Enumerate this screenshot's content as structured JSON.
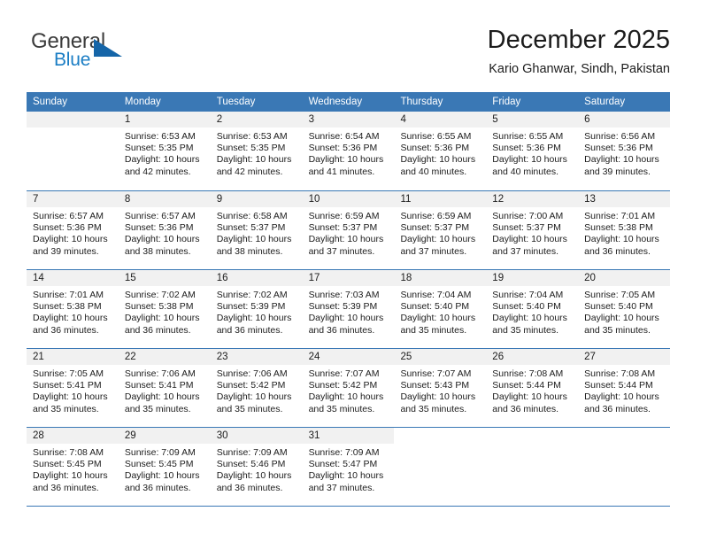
{
  "brand": {
    "word_one": "General",
    "word_two": "Blue",
    "logo_icon": "triangle-logo-icon"
  },
  "header": {
    "title": "December 2025",
    "subtitle": "Kario Ghanwar, Sindh, Pakistan"
  },
  "colors": {
    "header_blue": "#3a78b5",
    "brand_blue": "#1a7dc4",
    "logo_blue": "#1565a8",
    "day_band": "#f1f1f1",
    "text": "#1c1c1c"
  },
  "weekdays": [
    "Sunday",
    "Monday",
    "Tuesday",
    "Wednesday",
    "Thursday",
    "Friday",
    "Saturday"
  ],
  "weeks": [
    [
      {
        "day": "",
        "sunrise": "",
        "sunset": "",
        "daylight_line1": "",
        "daylight_line2": "",
        "empty": true
      },
      {
        "day": "1",
        "sunrise": "Sunrise: 6:53 AM",
        "sunset": "Sunset: 5:35 PM",
        "daylight_line1": "Daylight: 10 hours",
        "daylight_line2": "and 42 minutes."
      },
      {
        "day": "2",
        "sunrise": "Sunrise: 6:53 AM",
        "sunset": "Sunset: 5:35 PM",
        "daylight_line1": "Daylight: 10 hours",
        "daylight_line2": "and 42 minutes."
      },
      {
        "day": "3",
        "sunrise": "Sunrise: 6:54 AM",
        "sunset": "Sunset: 5:36 PM",
        "daylight_line1": "Daylight: 10 hours",
        "daylight_line2": "and 41 minutes."
      },
      {
        "day": "4",
        "sunrise": "Sunrise: 6:55 AM",
        "sunset": "Sunset: 5:36 PM",
        "daylight_line1": "Daylight: 10 hours",
        "daylight_line2": "and 40 minutes."
      },
      {
        "day": "5",
        "sunrise": "Sunrise: 6:55 AM",
        "sunset": "Sunset: 5:36 PM",
        "daylight_line1": "Daylight: 10 hours",
        "daylight_line2": "and 40 minutes."
      },
      {
        "day": "6",
        "sunrise": "Sunrise: 6:56 AM",
        "sunset": "Sunset: 5:36 PM",
        "daylight_line1": "Daylight: 10 hours",
        "daylight_line2": "and 39 minutes."
      }
    ],
    [
      {
        "day": "7",
        "sunrise": "Sunrise: 6:57 AM",
        "sunset": "Sunset: 5:36 PM",
        "daylight_line1": "Daylight: 10 hours",
        "daylight_line2": "and 39 minutes."
      },
      {
        "day": "8",
        "sunrise": "Sunrise: 6:57 AM",
        "sunset": "Sunset: 5:36 PM",
        "daylight_line1": "Daylight: 10 hours",
        "daylight_line2": "and 38 minutes."
      },
      {
        "day": "9",
        "sunrise": "Sunrise: 6:58 AM",
        "sunset": "Sunset: 5:37 PM",
        "daylight_line1": "Daylight: 10 hours",
        "daylight_line2": "and 38 minutes."
      },
      {
        "day": "10",
        "sunrise": "Sunrise: 6:59 AM",
        "sunset": "Sunset: 5:37 PM",
        "daylight_line1": "Daylight: 10 hours",
        "daylight_line2": "and 37 minutes."
      },
      {
        "day": "11",
        "sunrise": "Sunrise: 6:59 AM",
        "sunset": "Sunset: 5:37 PM",
        "daylight_line1": "Daylight: 10 hours",
        "daylight_line2": "and 37 minutes."
      },
      {
        "day": "12",
        "sunrise": "Sunrise: 7:00 AM",
        "sunset": "Sunset: 5:37 PM",
        "daylight_line1": "Daylight: 10 hours",
        "daylight_line2": "and 37 minutes."
      },
      {
        "day": "13",
        "sunrise": "Sunrise: 7:01 AM",
        "sunset": "Sunset: 5:38 PM",
        "daylight_line1": "Daylight: 10 hours",
        "daylight_line2": "and 36 minutes."
      }
    ],
    [
      {
        "day": "14",
        "sunrise": "Sunrise: 7:01 AM",
        "sunset": "Sunset: 5:38 PM",
        "daylight_line1": "Daylight: 10 hours",
        "daylight_line2": "and 36 minutes."
      },
      {
        "day": "15",
        "sunrise": "Sunrise: 7:02 AM",
        "sunset": "Sunset: 5:38 PM",
        "daylight_line1": "Daylight: 10 hours",
        "daylight_line2": "and 36 minutes."
      },
      {
        "day": "16",
        "sunrise": "Sunrise: 7:02 AM",
        "sunset": "Sunset: 5:39 PM",
        "daylight_line1": "Daylight: 10 hours",
        "daylight_line2": "and 36 minutes."
      },
      {
        "day": "17",
        "sunrise": "Sunrise: 7:03 AM",
        "sunset": "Sunset: 5:39 PM",
        "daylight_line1": "Daylight: 10 hours",
        "daylight_line2": "and 36 minutes."
      },
      {
        "day": "18",
        "sunrise": "Sunrise: 7:04 AM",
        "sunset": "Sunset: 5:40 PM",
        "daylight_line1": "Daylight: 10 hours",
        "daylight_line2": "and 35 minutes."
      },
      {
        "day": "19",
        "sunrise": "Sunrise: 7:04 AM",
        "sunset": "Sunset: 5:40 PM",
        "daylight_line1": "Daylight: 10 hours",
        "daylight_line2": "and 35 minutes."
      },
      {
        "day": "20",
        "sunrise": "Sunrise: 7:05 AM",
        "sunset": "Sunset: 5:40 PM",
        "daylight_line1": "Daylight: 10 hours",
        "daylight_line2": "and 35 minutes."
      }
    ],
    [
      {
        "day": "21",
        "sunrise": "Sunrise: 7:05 AM",
        "sunset": "Sunset: 5:41 PM",
        "daylight_line1": "Daylight: 10 hours",
        "daylight_line2": "and 35 minutes."
      },
      {
        "day": "22",
        "sunrise": "Sunrise: 7:06 AM",
        "sunset": "Sunset: 5:41 PM",
        "daylight_line1": "Daylight: 10 hours",
        "daylight_line2": "and 35 minutes."
      },
      {
        "day": "23",
        "sunrise": "Sunrise: 7:06 AM",
        "sunset": "Sunset: 5:42 PM",
        "daylight_line1": "Daylight: 10 hours",
        "daylight_line2": "and 35 minutes."
      },
      {
        "day": "24",
        "sunrise": "Sunrise: 7:07 AM",
        "sunset": "Sunset: 5:42 PM",
        "daylight_line1": "Daylight: 10 hours",
        "daylight_line2": "and 35 minutes."
      },
      {
        "day": "25",
        "sunrise": "Sunrise: 7:07 AM",
        "sunset": "Sunset: 5:43 PM",
        "daylight_line1": "Daylight: 10 hours",
        "daylight_line2": "and 35 minutes."
      },
      {
        "day": "26",
        "sunrise": "Sunrise: 7:08 AM",
        "sunset": "Sunset: 5:44 PM",
        "daylight_line1": "Daylight: 10 hours",
        "daylight_line2": "and 36 minutes."
      },
      {
        "day": "27",
        "sunrise": "Sunrise: 7:08 AM",
        "sunset": "Sunset: 5:44 PM",
        "daylight_line1": "Daylight: 10 hours",
        "daylight_line2": "and 36 minutes."
      }
    ],
    [
      {
        "day": "28",
        "sunrise": "Sunrise: 7:08 AM",
        "sunset": "Sunset: 5:45 PM",
        "daylight_line1": "Daylight: 10 hours",
        "daylight_line2": "and 36 minutes."
      },
      {
        "day": "29",
        "sunrise": "Sunrise: 7:09 AM",
        "sunset": "Sunset: 5:45 PM",
        "daylight_line1": "Daylight: 10 hours",
        "daylight_line2": "and 36 minutes."
      },
      {
        "day": "30",
        "sunrise": "Sunrise: 7:09 AM",
        "sunset": "Sunset: 5:46 PM",
        "daylight_line1": "Daylight: 10 hours",
        "daylight_line2": "and 36 minutes."
      },
      {
        "day": "31",
        "sunrise": "Sunrise: 7:09 AM",
        "sunset": "Sunset: 5:47 PM",
        "daylight_line1": "Daylight: 10 hours",
        "daylight_line2": "and 37 minutes."
      },
      {
        "day": "",
        "sunrise": "",
        "sunset": "",
        "daylight_line1": "",
        "daylight_line2": "",
        "empty": true,
        "blank": true
      },
      {
        "day": "",
        "sunrise": "",
        "sunset": "",
        "daylight_line1": "",
        "daylight_line2": "",
        "empty": true,
        "blank": true
      },
      {
        "day": "",
        "sunrise": "",
        "sunset": "",
        "daylight_line1": "",
        "daylight_line2": "",
        "empty": true,
        "blank": true
      }
    ]
  ]
}
